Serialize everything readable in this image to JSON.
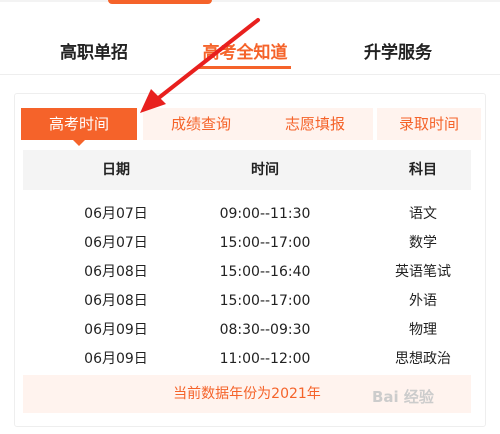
{
  "main_tabs": [
    {
      "label": "高职单招",
      "active": false
    },
    {
      "label": "高考全知道",
      "active": true
    },
    {
      "label": "升学服务",
      "active": false
    }
  ],
  "sub_tabs": [
    {
      "label": "高考时间",
      "active": true
    },
    {
      "label": "成绩查询",
      "active": false
    },
    {
      "label": "志愿填报",
      "active": false
    },
    {
      "label": "录取时间",
      "active": false
    }
  ],
  "table": {
    "headers": [
      "日期",
      "时间",
      "科目"
    ],
    "rows": [
      [
        "06月07日",
        "09:00--11:30",
        "语文"
      ],
      [
        "06月07日",
        "15:00--17:00",
        "数学"
      ],
      [
        "06月08日",
        "15:00--16:40",
        "英语笔试"
      ],
      [
        "06月08日",
        "15:00--17:00",
        "外语"
      ],
      [
        "06月09日",
        "08:30--09:30",
        "物理"
      ],
      [
        "06月09日",
        "11:00--12:00",
        "思想政治"
      ]
    ]
  },
  "footer_note": "当前数据年份为2021年",
  "watermark": "Bai 经验",
  "colors": {
    "accent": "#f5632a",
    "accent_light": "#fff3ee",
    "annotation_arrow": "#e8201e"
  }
}
